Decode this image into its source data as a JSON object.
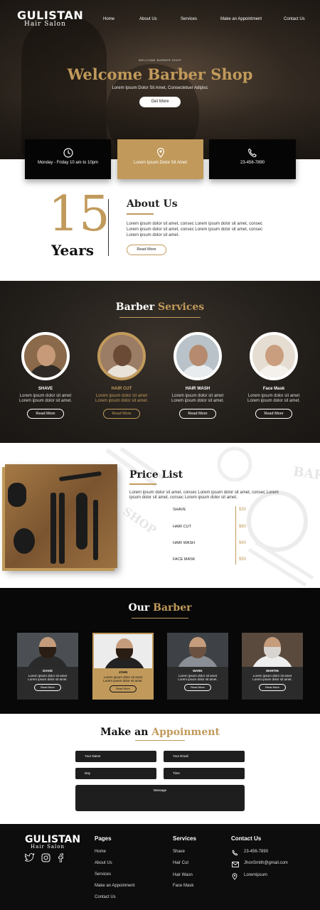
{
  "brand": {
    "name": "GULISTAN",
    "tagline": "Hair Salon"
  },
  "nav": [
    "Home",
    "About Us",
    "Services",
    "Make an Appointment",
    "Contact Us"
  ],
  "hero": {
    "kicker": "WELCOME BARBER SHOP",
    "title": "Welcome Barber Shop",
    "subtitle": "Lorem Ipsum Dolor Sit Amet, Consectetuer Adipisc",
    "button": "Get More"
  },
  "info": {
    "hours": "Monday - Friday 10 am to 10pm",
    "address": "Lorem Ipsum Dolor Sit Amet",
    "phone": "23-456-7890"
  },
  "about": {
    "number": "15",
    "years": "Years",
    "title": "About Us",
    "text": "Lorem ipsum dolor sit amet, consec Lorem ipsum dolor sit amet, consec Lorem ipsum dolor sit amet, consec Lorem ipsum dolor sit amet, consec Lorem ipsum dolor sit amet.",
    "button": "Read More"
  },
  "services": {
    "title_a": "Barber",
    "title_b": "Services",
    "items": [
      {
        "name": "SHAVE",
        "desc": "Lorem ipsum dolor sit amet\nLorem ipsum dolor sit amet.",
        "button": "Read More"
      },
      {
        "name": "HAIR CUT",
        "desc": "Lorem ipsum dolor sit amet\nLorem ipsum dolor sit amet.",
        "button": "Read More"
      },
      {
        "name": "HAIR WASH",
        "desc": "Lorem ipsum dolor sit amet\nLorem ipsum dolor sit amet.",
        "button": "Read More"
      },
      {
        "name": "Face Mask",
        "desc": "Lorem ipsum dolor sit amet\nLorem ipsum dolor sit amet.",
        "button": "Read More"
      }
    ]
  },
  "price": {
    "title": "Price List",
    "text": "Lorem ipsum dolor sit amet, consec Lorem ipsum dolor sit amet, consec Lorem ipsum dolor sit amet, consec Lorem ipsum dolor sit amet.",
    "items": [
      {
        "name": "SHAVE",
        "price": "$30"
      },
      {
        "name": "HAIR CUT",
        "price": "$60"
      },
      {
        "name": "HAIR WASH",
        "price": "$40"
      },
      {
        "name": "FACE MASK",
        "price": "$50"
      }
    ],
    "watermark": [
      "BARBER",
      "SHOP"
    ]
  },
  "barbers": {
    "title_a": "Our",
    "title_b": "Barber",
    "items": [
      {
        "name": "DAVID",
        "desc": "Lorem ipsum dolor sit amet\nLorem ipsum dolor sit amet.",
        "button": "Read More"
      },
      {
        "name": "JOHN",
        "desc": "Lorem ipsum dolor sit amet\nLorem ipsum dolor sit amet.",
        "button": "Read More"
      },
      {
        "name": "MARK",
        "desc": "Lorem ipsum dolor sit amet\nLorem ipsum dolor sit amet.",
        "button": "Read More"
      },
      {
        "name": "MARTIN",
        "desc": "Lorem ipsum dolor sit amet\nLorem ipsum dolor sit amet.",
        "button": "Read More"
      }
    ]
  },
  "appointment": {
    "title_a": "Make an",
    "title_b": "Appoinment",
    "fields": [
      "Your Name",
      "Your Email",
      "Day",
      "Time",
      "Message"
    ]
  },
  "footer": {
    "pages_title": "Pages",
    "pages": [
      "Home",
      "About Us",
      "Services",
      "Make an Appoinment",
      "Contact Us"
    ],
    "services_title": "Services",
    "services": [
      "Shave",
      "Hair Cut",
      "Hair Wasn",
      "Face Mask"
    ],
    "contact_title": "Contact Us",
    "contact": [
      "23-456-7890",
      "JhonSmith@gmail.com",
      "Loremipsum"
    ],
    "social_icons": [
      "twitter-icon",
      "instagram-icon",
      "facebook-icon"
    ]
  },
  "colors": {
    "gold": "#c19a5b",
    "dark": "#0d0d0d"
  }
}
